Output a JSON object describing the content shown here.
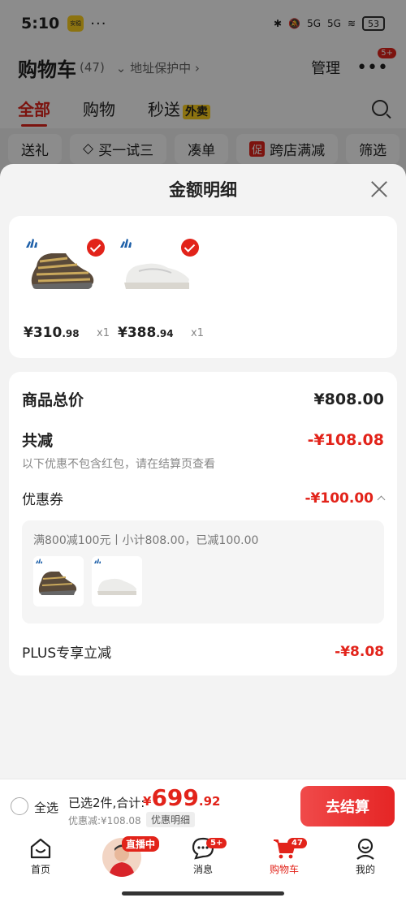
{
  "status": {
    "time": "5:10",
    "app_badge": "安稳",
    "dots": "···",
    "net1": "5G",
    "net2": "5G",
    "battery": "53"
  },
  "header": {
    "title": "购物车",
    "count": "(47)",
    "address": "地址保护中",
    "manage": "管理",
    "more_badge": "5+"
  },
  "tabs": [
    {
      "label": "全部"
    },
    {
      "label": "购物"
    },
    {
      "label": "秒送"
    }
  ],
  "tabs_extra": {
    "waimai": "外卖"
  },
  "chips": [
    "送礼",
    "买一试三",
    "凑单",
    "跨店满减",
    "筛选"
  ],
  "chip_promo_tag": "促",
  "sheet": {
    "title": "金额明细",
    "products": [
      {
        "price_int": "¥310",
        "price_dec": ".98",
        "qty": "x1",
        "image": "black-sneaker"
      },
      {
        "price_int": "¥388",
        "price_dec": ".94",
        "qty": "x1",
        "image": "white-sneaker"
      }
    ],
    "total_label": "商品总价",
    "total_value": "¥808.00",
    "discount_label": "共减",
    "discount_value": "-¥108.08",
    "discount_note": "以下优惠不包含红包，请在结算页查看",
    "coupon_label": "优惠券",
    "coupon_value": "-¥100.00",
    "coupon_desc": "满800减100元丨小计808.00，已减100.00",
    "plus_label": "PLUS专享立减",
    "plus_value": "-¥8.08"
  },
  "checkout": {
    "select_all": "全选",
    "selected": "已选2件,合计:",
    "yen": "¥",
    "total_int": "699",
    "total_dec": ".92",
    "saved": "优惠减:¥108.08",
    "detail": "优惠明细",
    "pay": "去结算"
  },
  "nav": {
    "home": "首页",
    "live": "直播中",
    "messages": "消息",
    "messages_badge": "5+",
    "cart": "购物车",
    "cart_badge": "47",
    "mine": "我的"
  },
  "colors": {
    "accent": "#e2231a"
  }
}
